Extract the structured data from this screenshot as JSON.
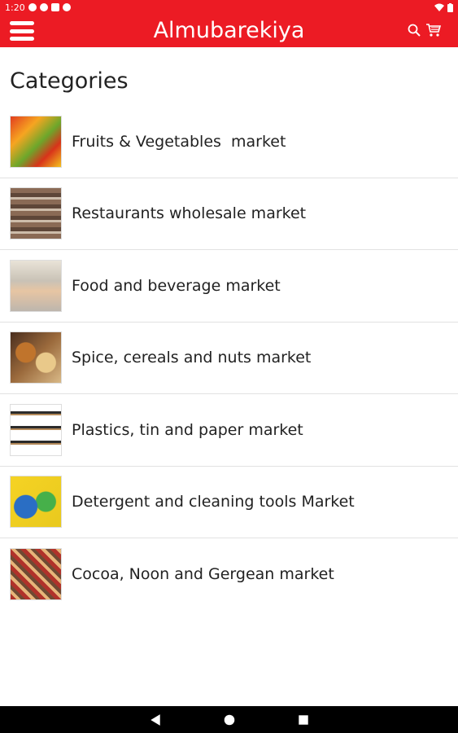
{
  "status": {
    "time": "1:20"
  },
  "app": {
    "title": "Almubarekiya"
  },
  "page": {
    "title": "Categories"
  },
  "categories": [
    {
      "label": "Fruits & Vegetables  market",
      "image": "fruits-vegetables-thumbnail"
    },
    {
      "label": "Restaurants wholesale market",
      "image": "restaurants-wholesale-thumbnail"
    },
    {
      "label": "Food and beverage market",
      "image": "food-beverage-thumbnail"
    },
    {
      "label": "Spice, cereals and nuts market",
      "image": "spice-cereals-nuts-thumbnail"
    },
    {
      "label": "Plastics, tin and paper market",
      "image": "plastics-tin-paper-thumbnail"
    },
    {
      "label": "Detergent and cleaning tools Market",
      "image": "detergent-cleaning-thumbnail"
    },
    {
      "label": "Cocoa, Noon and Gergean market",
      "image": "cocoa-noon-gergean-thumbnail"
    }
  ],
  "icons": {
    "menu": "menu-icon",
    "search": "search-icon",
    "cart": "cart-icon"
  },
  "colors": {
    "primary": "#ec1b24"
  }
}
